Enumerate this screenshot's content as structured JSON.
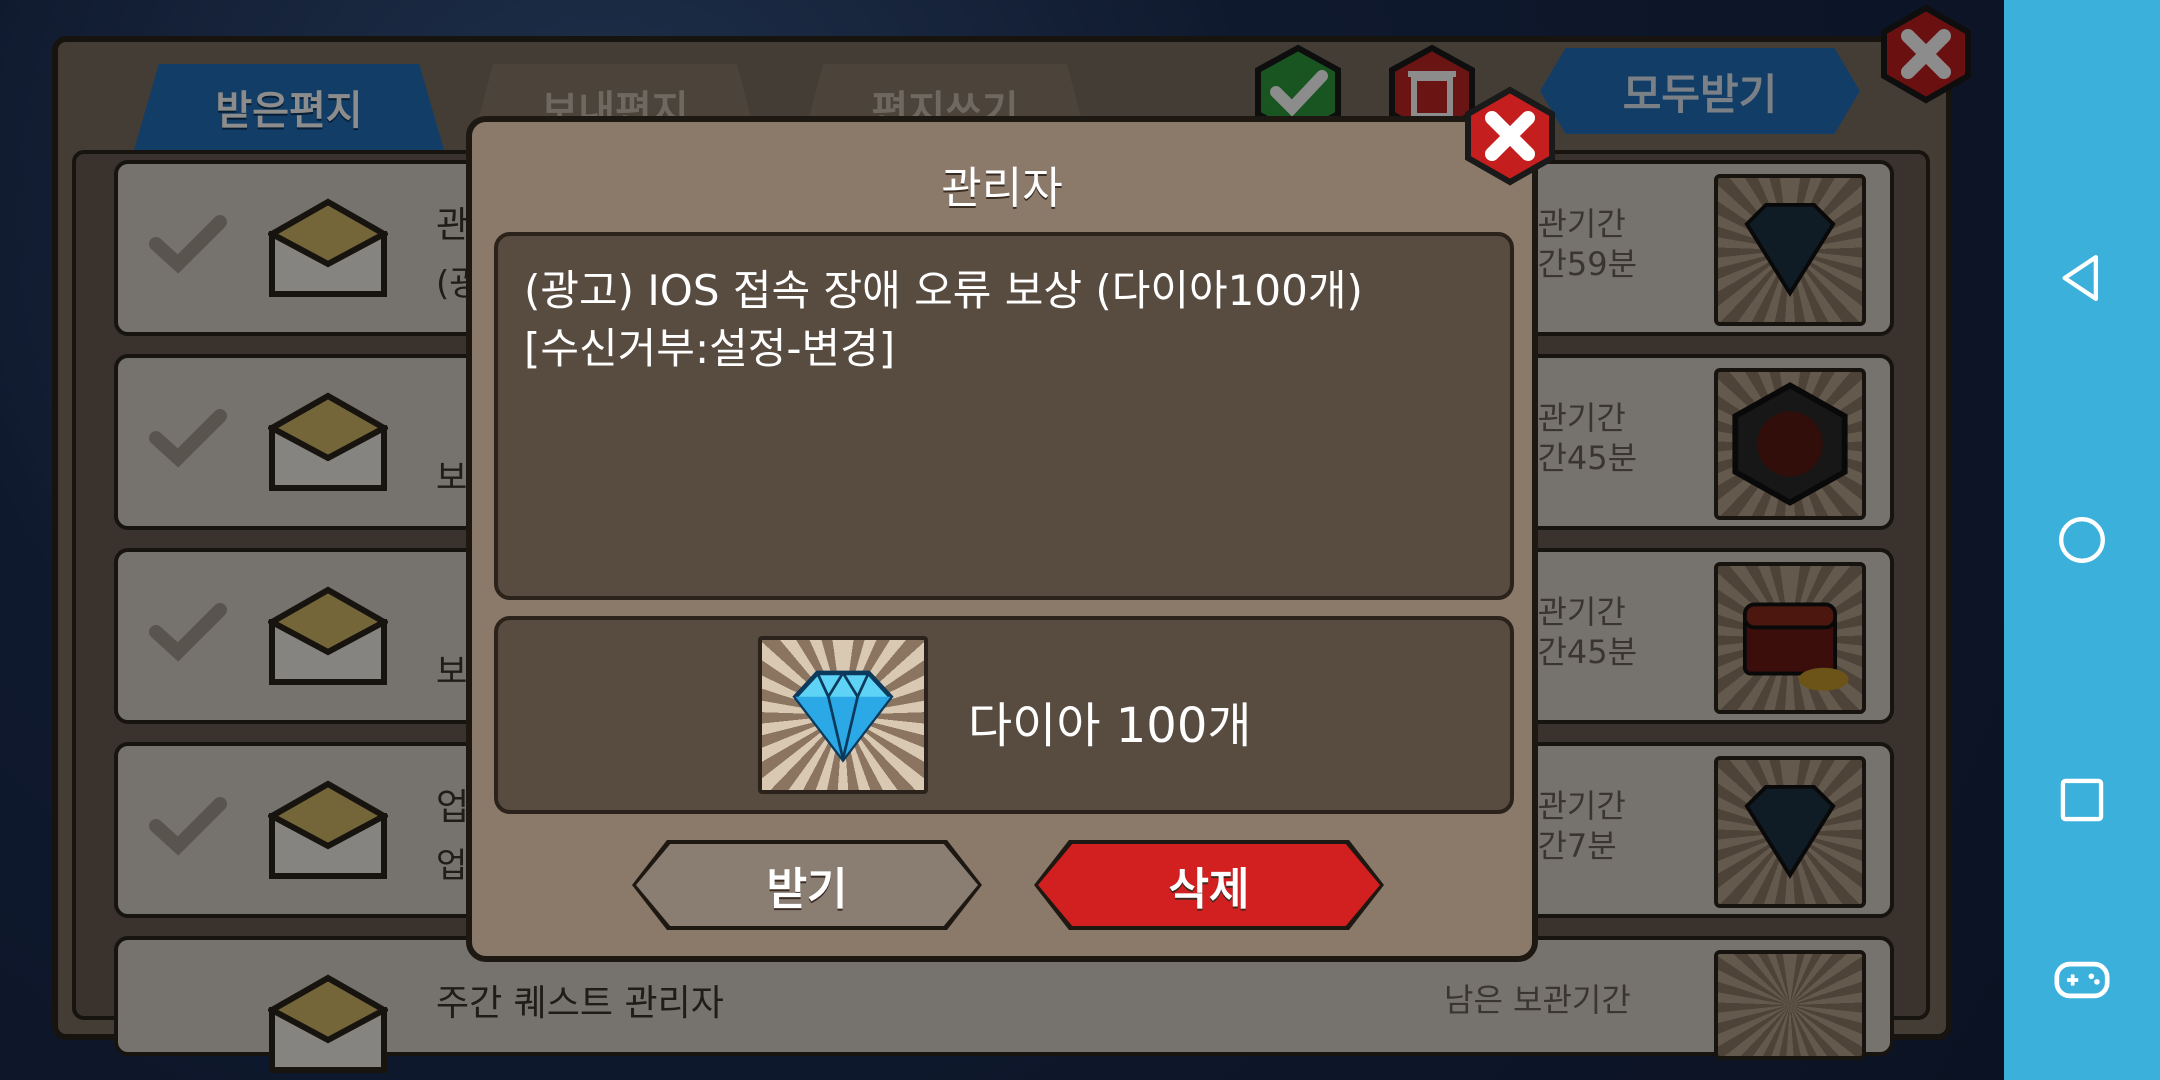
{
  "mailbox": {
    "tabs": [
      {
        "label": "받은편지"
      },
      {
        "label": "보내편지"
      },
      {
        "label": "편지쓰기"
      }
    ],
    "receive_all_label": "모두받기",
    "rows": [
      {
        "title": "관",
        "subtitle": "(광",
        "keep_label": "보관기간",
        "keep_time": "시간59분",
        "item_icon": "dark-diamond-icon"
      },
      {
        "title": "",
        "subtitle": "보",
        "keep_label": "보관기간",
        "keep_time": "시간45분",
        "item_icon": "fire-emblem-icon"
      },
      {
        "title": "",
        "subtitle": "보",
        "keep_label": "보관기간",
        "keep_time": "시간45분",
        "item_icon": "treasure-chest-icon"
      },
      {
        "title": "업",
        "subtitle": "업",
        "keep_label": "보관기간",
        "keep_time": "시간7분",
        "item_icon": "dark-diamond-icon"
      },
      {
        "title": "주간 퀘스트 관리자",
        "subtitle": "",
        "keep_label": "남은 보관기간",
        "keep_time": "",
        "item_icon": "gold-item-icon"
      }
    ]
  },
  "modal": {
    "title": "관리자",
    "message_line1": "(광고) IOS 접속 장애 오류 보상 (다이아100개)",
    "message_line2": "[수신거부:설정-변경]",
    "reward_label": "다이아 100개",
    "reward_icon": "diamond-icon",
    "receive_label": "받기",
    "delete_label": "삭제"
  },
  "colors": {
    "accent_blue": "#1f6fba",
    "delete_red": "#d21f1f",
    "nav_bar": "#3ab0db"
  }
}
